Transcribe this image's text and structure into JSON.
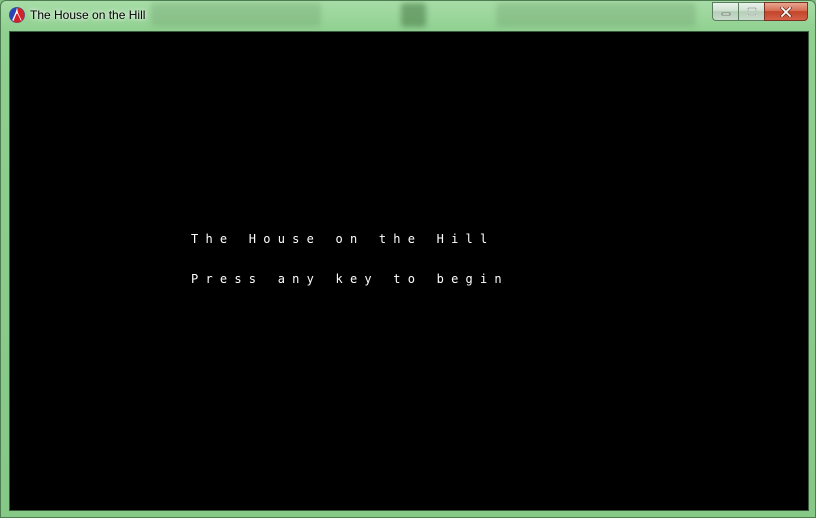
{
  "window": {
    "title": "The House on the Hill",
    "app_icon": "racket-logo-icon",
    "controls": {
      "minimize_icon": "minimize-icon",
      "maximize_icon": "maximize-icon",
      "close_icon": "close-icon"
    }
  },
  "screen": {
    "title_text": "T h e   H o u s e   o n   t h e   H i l l",
    "prompt_text": "P r e s s   a n y   k e y   t o   b e g i n",
    "background": "#000000",
    "text_color": "#ffffff"
  },
  "colors": {
    "frame": "#8bcb8b",
    "close_button": "#c2442a"
  }
}
